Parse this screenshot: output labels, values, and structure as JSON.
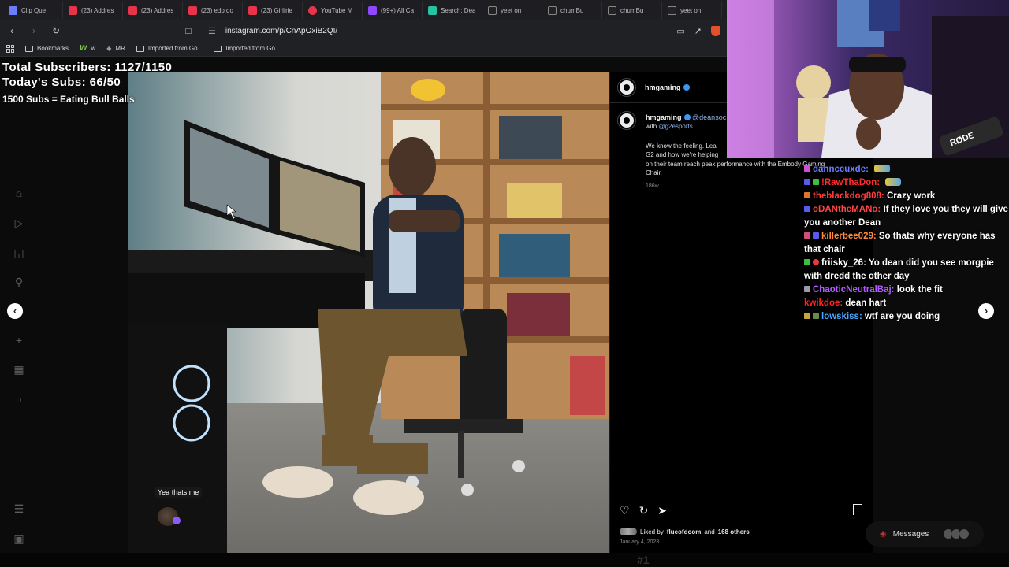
{
  "tabs": [
    {
      "label": "Clip Que",
      "color": "#6b7cff"
    },
    {
      "label": "(23) Addres",
      "color": "#e8334a"
    },
    {
      "label": "(23) Addres",
      "color": "#e8334a"
    },
    {
      "label": "(23) edp do",
      "color": "#e8334a"
    },
    {
      "label": "(23) Girlfrie",
      "color": "#e8334a"
    },
    {
      "label": "YouTube M",
      "color": "#e8334a"
    },
    {
      "label": "(99+) All Ca",
      "color": "#9147ff"
    },
    {
      "label": "Search: Dea",
      "color": "#27c2a0"
    },
    {
      "label": "yeet on",
      "color": "#222222"
    },
    {
      "label": "chumBu",
      "color": "#222222"
    },
    {
      "label": "chumBu",
      "color": "#222222"
    },
    {
      "label": "yeet on",
      "color": "#222222"
    }
  ],
  "address": {
    "url": "instagram.com/p/CnApOxiB2QI/"
  },
  "bookmarks": [
    {
      "label": "Bookmarks",
      "type": "bookmarks"
    },
    {
      "label": "w",
      "type": "w"
    },
    {
      "label": "MR",
      "type": "mr"
    },
    {
      "label": "Imported from Go...",
      "type": "folder"
    },
    {
      "label": "Imported from Go...",
      "type": "folder"
    }
  ],
  "overlay": {
    "line1": "Total Subscribers: 1127/1150",
    "line2": "Today's Subs: 66/50",
    "line3": "1500 Subs = Eating Bull Balls"
  },
  "photo": {
    "comment_bubble": "Yea thats me"
  },
  "post": {
    "header_username": "hmgaming",
    "caption_username": "hmgaming",
    "caption_mention": "@deansoc",
    "caption_with": "with",
    "caption_with_mention": "@g2esports.",
    "caption_lines": [
      "We know the feeling. Lea",
      "G2 and how we're helping",
      "on their team reach peak performance with the Embody Gaming",
      "Chair."
    ],
    "age": "186w",
    "liked_by_prefix": "Liked by",
    "liked_by_user": "flueofdoom",
    "liked_by_and": "and",
    "liked_by_others": "168 others",
    "date": "January 4, 2023"
  },
  "chat": [
    {
      "name": "dannccuxde:",
      "color": "#6f7cff",
      "text": "",
      "emote": true
    },
    {
      "name": "!RawThaDon:",
      "color": "#ff2d2d",
      "text": "",
      "emote": true
    },
    {
      "name": "theblackdog808:",
      "color": "#ff3b3b",
      "text": "Crazy work"
    },
    {
      "name": "oDANtheMANo:",
      "color": "#ff4646",
      "text": "If they love you they will give you another Dean"
    },
    {
      "name": "killerbee029:",
      "color": "#ff8a3a",
      "text": "So thats why everyone has that chair"
    },
    {
      "name": "friisky_26:",
      "color": "#ffffff",
      "text": "Yo dean did you see morgpie with dredd the other day"
    },
    {
      "name": "ChaoticNeutralBaj:",
      "color": "#b05cff",
      "text": "look the fit"
    },
    {
      "name": "kwikdoe:",
      "color": "#ff2222",
      "text": "dean hart"
    },
    {
      "name": "lowskiss:",
      "color": "#46a8ff",
      "text": "wtf are you doing"
    }
  ],
  "messages": {
    "label": "Messages"
  },
  "bottom": {
    "text": "#1"
  },
  "colors": {
    "instagram_blue": "#3b97f0",
    "background": "#000000"
  }
}
